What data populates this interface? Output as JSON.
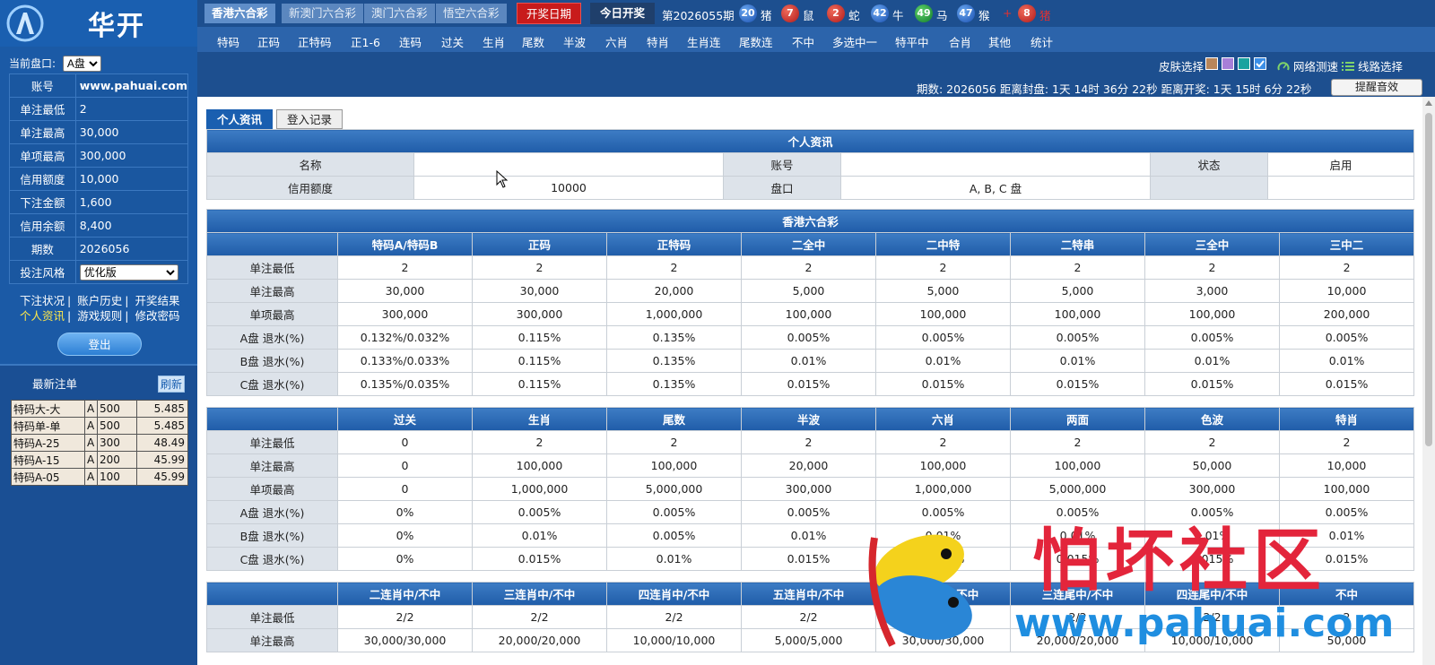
{
  "brand": {
    "title": "华开"
  },
  "sidebar": {
    "pankou_label": "当前盘口:",
    "pankou_value": "A盘",
    "info": [
      {
        "key": "账号",
        "value": "www.pahuai.com"
      },
      {
        "key": "单注最低",
        "value": "2"
      },
      {
        "key": "单注最高",
        "value": "30,000"
      },
      {
        "key": "单项最高",
        "value": "300,000"
      },
      {
        "key": "信用额度",
        "value": "10,000"
      },
      {
        "key": "下注金额",
        "value": "1,600"
      },
      {
        "key": "信用余额",
        "value": "8,400"
      },
      {
        "key": "期数",
        "value": "2026056"
      },
      {
        "key": "投注风格",
        "value": "优化版"
      }
    ],
    "links": [
      "下注状况",
      "账户历史",
      "开奖结果",
      "个人资讯",
      "游戏规则",
      "修改密码"
    ],
    "logout": "登出",
    "recent_title": "最新注单",
    "refresh": "刷新",
    "recent": [
      {
        "item": "特码大-大",
        "pan": "A",
        "amount": "500",
        "odds": "5.485"
      },
      {
        "item": "特码单-单",
        "pan": "A",
        "amount": "500",
        "odds": "5.485"
      },
      {
        "item": "特码A-25",
        "pan": "A",
        "amount": "300",
        "odds": "48.49"
      },
      {
        "item": "特码A-15",
        "pan": "A",
        "amount": "200",
        "odds": "45.99"
      },
      {
        "item": "特码A-05",
        "pan": "A",
        "amount": "100",
        "odds": "45.99"
      }
    ]
  },
  "topbar": {
    "lotteries": [
      "香港六合彩",
      "新澳门六合彩",
      "澳门六合彩",
      "悟空六合彩"
    ],
    "open_date": "开奖日期",
    "today_open": "今日开奖",
    "issue": "第2026055期",
    "balls": [
      {
        "num": "20",
        "zodiac": "猪",
        "color": "blue"
      },
      {
        "num": "7",
        "zodiac": "鼠",
        "color": "red"
      },
      {
        "num": "2",
        "zodiac": "蛇",
        "color": "red"
      },
      {
        "num": "42",
        "zodiac": "牛",
        "color": "blue"
      },
      {
        "num": "49",
        "zodiac": "马",
        "color": "green"
      },
      {
        "num": "47",
        "zodiac": "猴",
        "color": "blue"
      }
    ],
    "tail": {
      "plus": "+",
      "num": "8",
      "zodiac": "猪"
    }
  },
  "menu": [
    "特码",
    "正码",
    "正特码",
    "正1-6",
    "连码",
    "过关",
    "生肖",
    "尾数",
    "半波",
    "六肖",
    "特肖",
    "生肖连",
    "尾数连",
    "不中",
    "多选中一",
    "特平中",
    "合肖",
    "其他",
    "统计"
  ],
  "toolbar": {
    "skin": "皮肤选择",
    "swatches": [
      "#b8865a",
      "#a77fd8",
      "#1aa39f",
      "#3b8ee6"
    ],
    "net_test": "网络测速",
    "line_select": "线路选择"
  },
  "status": {
    "text": "期数: 2026056    距离封盘: 1天 14时 36分 22秒   距离开奖: 1天 15时 6分 22秒",
    "sound": "提醒音效"
  },
  "tabs": [
    "个人资讯",
    "登入记录"
  ],
  "profile": {
    "caption": "个人资讯",
    "name_label": "名称",
    "name_value": "",
    "account_label": "账号",
    "account_value": "",
    "status_label": "状态",
    "status_value": "启用",
    "credit_label": "信用额度",
    "credit_value": "10000",
    "pan_label": "盘口",
    "pan_value": "A, B, C 盘"
  },
  "limits1": {
    "caption": "香港六合彩",
    "headers": [
      "特码A/特码B",
      "正码",
      "正特码",
      "二全中",
      "二中特",
      "二特串",
      "三全中",
      "三中二"
    ],
    "rows": [
      {
        "label": "单注最低",
        "cells": [
          "2",
          "2",
          "2",
          "2",
          "2",
          "2",
          "2",
          "2"
        ]
      },
      {
        "label": "单注最高",
        "cells": [
          "30,000",
          "30,000",
          "20,000",
          "5,000",
          "5,000",
          "5,000",
          "3,000",
          "10,000"
        ]
      },
      {
        "label": "单项最高",
        "cells": [
          "300,000",
          "300,000",
          "1,000,000",
          "100,000",
          "100,000",
          "100,000",
          "100,000",
          "200,000"
        ]
      },
      {
        "label": "A盘 退水(%)",
        "cells": [
          "0.132%/0.032%",
          "0.115%",
          "0.135%",
          "0.005%",
          "0.005%",
          "0.005%",
          "0.005%",
          "0.005%"
        ]
      },
      {
        "label": "B盘 退水(%)",
        "cells": [
          "0.133%/0.033%",
          "0.115%",
          "0.135%",
          "0.01%",
          "0.01%",
          "0.01%",
          "0.01%",
          "0.01%"
        ]
      },
      {
        "label": "C盘 退水(%)",
        "cells": [
          "0.135%/0.035%",
          "0.115%",
          "0.135%",
          "0.015%",
          "0.015%",
          "0.015%",
          "0.015%",
          "0.015%"
        ]
      }
    ]
  },
  "limits2": {
    "headers": [
      "过关",
      "生肖",
      "尾数",
      "半波",
      "六肖",
      "两面",
      "色波",
      "特肖"
    ],
    "rows": [
      {
        "label": "单注最低",
        "cells": [
          "0",
          "2",
          "2",
          "2",
          "2",
          "2",
          "2",
          "2"
        ]
      },
      {
        "label": "单注最高",
        "cells": [
          "0",
          "100,000",
          "100,000",
          "20,000",
          "100,000",
          "100,000",
          "50,000",
          "10,000"
        ]
      },
      {
        "label": "单项最高",
        "cells": [
          "0",
          "1,000,000",
          "5,000,000",
          "300,000",
          "1,000,000",
          "5,000,000",
          "300,000",
          "100,000"
        ]
      },
      {
        "label": "A盘 退水(%)",
        "cells": [
          "0%",
          "0.005%",
          "0.005%",
          "0.005%",
          "0.005%",
          "0.005%",
          "0.005%",
          "0.005%"
        ]
      },
      {
        "label": "B盘 退水(%)",
        "cells": [
          "0%",
          "0.01%",
          "0.005%",
          "0.01%",
          "0.01%",
          "0.01%",
          "0.01%",
          "0.01%"
        ]
      },
      {
        "label": "C盘 退水(%)",
        "cells": [
          "0%",
          "0.015%",
          "0.01%",
          "0.015%",
          "0.015%",
          "0.015%",
          "0.015%",
          "0.015%"
        ]
      }
    ]
  },
  "limits3": {
    "headers": [
      "二连肖中/不中",
      "三连肖中/不中",
      "四连肖中/不中",
      "五连肖中/不中",
      "二连尾中/不中",
      "三连尾中/不中",
      "四连尾中/不中",
      "不中"
    ],
    "rows": [
      {
        "label": "单注最低",
        "cells": [
          "2/2",
          "2/2",
          "2/2",
          "2/2",
          "2/2",
          "2/2",
          "2/2",
          "2"
        ]
      },
      {
        "label": "单注最高",
        "cells": [
          "30,000/30,000",
          "20,000/20,000",
          "10,000/10,000",
          "5,000/5,000",
          "30,000/30,000",
          "20,000/20,000",
          "10,000/10,000",
          "50,000"
        ]
      }
    ]
  },
  "watermark": {
    "title": "怕坏社区",
    "url": "www.pahuai.com"
  }
}
